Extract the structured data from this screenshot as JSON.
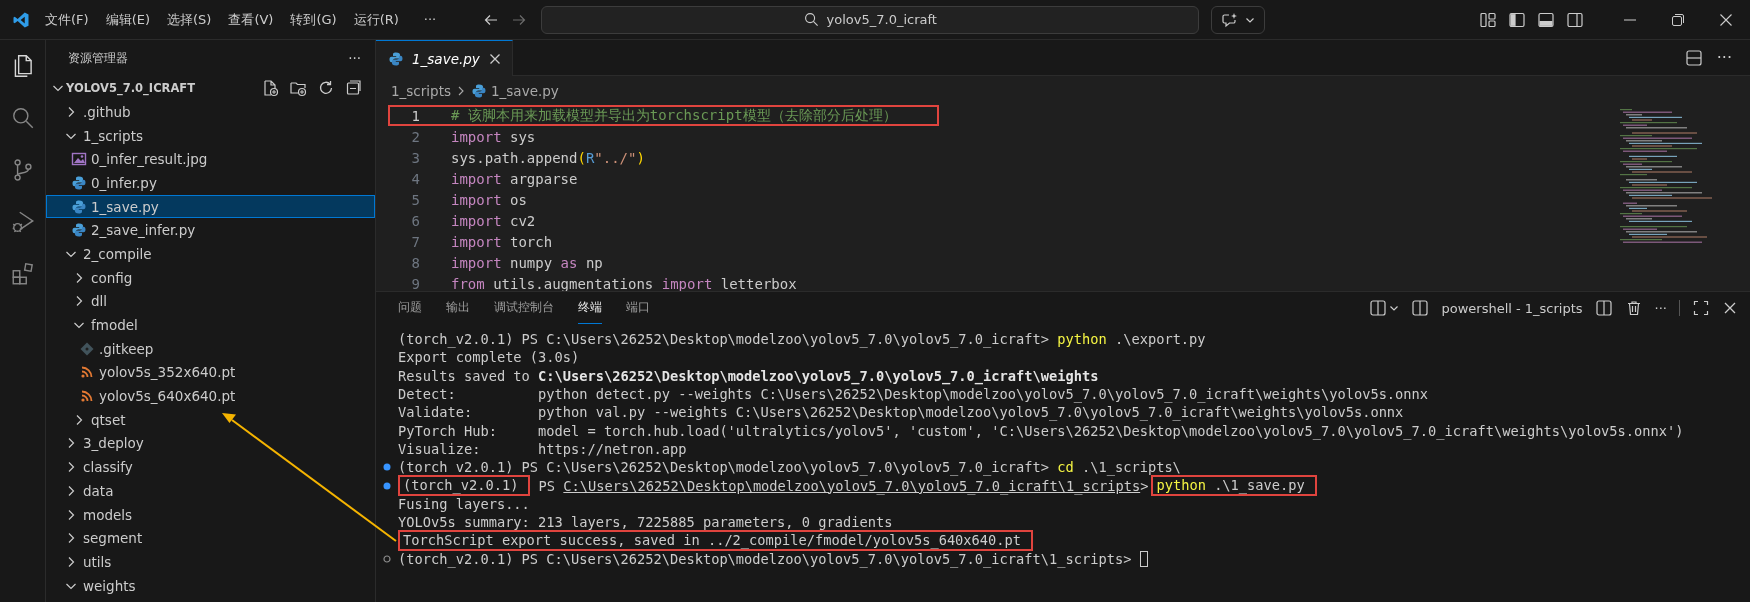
{
  "title_bar": {
    "menus": [
      "文件(F)",
      "编辑(E)",
      "选择(S)",
      "查看(V)",
      "转到(G)",
      "运行(R)"
    ],
    "more": "···",
    "back_disabled": false,
    "forward_disabled": true,
    "search": {
      "value": "yolov5_7.0_icraft"
    }
  },
  "activity_bar": [
    {
      "kind": "explorer",
      "selected": true
    },
    {
      "kind": "search",
      "selected": false
    },
    {
      "kind": "source-control",
      "selected": false
    },
    {
      "kind": "run-debug",
      "selected": false
    },
    {
      "kind": "extensions",
      "selected": false
    }
  ],
  "explorer": {
    "title": "资源管理器",
    "more": "···",
    "root": {
      "label": "YOLOV5_7.0_ICRAFT",
      "expanded": true
    },
    "tree": [
      {
        "label": ".github",
        "kind": "folder",
        "expanded": false,
        "selected": false
      },
      {
        "label": "1_scripts",
        "kind": "folder",
        "expanded": true,
        "selected": false,
        "children": [
          {
            "label": "0_infer_result.jpg",
            "kind": "image",
            "selected": false
          },
          {
            "label": "0_infer.py",
            "kind": "python",
            "selected": false
          },
          {
            "label": "1_save.py",
            "kind": "python",
            "selected": true
          },
          {
            "label": "2_save_infer.py",
            "kind": "python",
            "selected": false
          }
        ]
      },
      {
        "label": "2_compile",
        "kind": "folder",
        "expanded": true,
        "selected": false,
        "children": [
          {
            "label": "config",
            "kind": "folder",
            "expanded": false,
            "selected": false
          },
          {
            "label": "dll",
            "kind": "folder",
            "expanded": false,
            "selected": false
          },
          {
            "label": "fmodel",
            "kind": "folder",
            "expanded": true,
            "selected": false,
            "children": [
              {
                "label": ".gitkeep",
                "kind": "git",
                "selected": false
              },
              {
                "label": "yolov5s_352x640.pt",
                "kind": "model",
                "selected": false
              },
              {
                "label": "yolov5s_640x640.pt",
                "kind": "model",
                "selected": false,
                "pointed": true
              }
            ]
          },
          {
            "label": "qtset",
            "kind": "folder",
            "expanded": false,
            "selected": false
          }
        ]
      },
      {
        "label": "3_deploy",
        "kind": "folder",
        "expanded": false,
        "selected": false
      },
      {
        "label": "classify",
        "kind": "folder",
        "expanded": false,
        "selected": false
      },
      {
        "label": "data",
        "kind": "folder",
        "expanded": false,
        "selected": false
      },
      {
        "label": "models",
        "kind": "folder",
        "expanded": false,
        "selected": false
      },
      {
        "label": "segment",
        "kind": "folder",
        "expanded": false,
        "selected": false
      },
      {
        "label": "utils",
        "kind": "folder",
        "expanded": false,
        "selected": false
      },
      {
        "label": "weights",
        "kind": "folder",
        "expanded": true,
        "selected": false
      }
    ]
  },
  "editor": {
    "tabs": [
      {
        "label": "1_save.py",
        "selected": true
      }
    ],
    "more": "···",
    "breadcrumb": [
      "1_scripts",
      "1_save.py"
    ],
    "lines": [
      {
        "number": "1",
        "boxed": true,
        "tokens": [
          {
            "text": "# 该脚本用来加载模型并导出为torchscript模型（去除部分后处理）",
            "kind": "comment"
          }
        ]
      },
      {
        "number": "2",
        "boxed": false,
        "tokens": [
          {
            "text": "import",
            "kind": "keyword"
          },
          {
            "text": " sys",
            "kind": "plain"
          }
        ]
      },
      {
        "number": "3",
        "boxed": false,
        "tokens": [
          {
            "text": "sys.path.append",
            "kind": "plain"
          },
          {
            "text": "(",
            "kind": "bracket"
          },
          {
            "text": "R",
            "kind": "prefix"
          },
          {
            "text": "\"../\"",
            "kind": "string"
          },
          {
            "text": ")",
            "kind": "bracket"
          }
        ]
      },
      {
        "number": "4",
        "boxed": false,
        "tokens": [
          {
            "text": "import",
            "kind": "keyword"
          },
          {
            "text": " argparse",
            "kind": "plain"
          }
        ]
      },
      {
        "number": "5",
        "boxed": false,
        "tokens": [
          {
            "text": "import",
            "kind": "keyword"
          },
          {
            "text": " os",
            "kind": "plain"
          }
        ]
      },
      {
        "number": "6",
        "boxed": false,
        "tokens": [
          {
            "text": "import",
            "kind": "keyword"
          },
          {
            "text": " cv2",
            "kind": "plain"
          }
        ]
      },
      {
        "number": "7",
        "boxed": false,
        "tokens": [
          {
            "text": "import",
            "kind": "keyword"
          },
          {
            "text": " torch",
            "kind": "plain"
          }
        ]
      },
      {
        "number": "8",
        "boxed": false,
        "tokens": [
          {
            "text": "import",
            "kind": "keyword"
          },
          {
            "text": " numpy ",
            "kind": "plain"
          },
          {
            "text": "as",
            "kind": "keyword"
          },
          {
            "text": " np",
            "kind": "plain"
          }
        ]
      },
      {
        "number": "9",
        "boxed": false,
        "tokens": [
          {
            "text": "from",
            "kind": "keyword"
          },
          {
            "text": " utils.augmentations ",
            "kind": "plain"
          },
          {
            "text": "import",
            "kind": "keyword"
          },
          {
            "text": " letterbox",
            "kind": "plain"
          }
        ]
      }
    ]
  },
  "panel": {
    "tabs": [
      {
        "label": "问题",
        "selected": false
      },
      {
        "label": "输出",
        "selected": false
      },
      {
        "label": "调试控制台",
        "selected": false
      },
      {
        "label": "终端",
        "selected": true
      },
      {
        "label": "端口",
        "selected": false
      }
    ],
    "terminal_name": "powershell - 1_scripts",
    "more": "···",
    "lines": [
      {
        "decorated": false,
        "cursor": false,
        "segments": [
          {
            "text": "(torch_v2.0.1) PS C:\\Users\\26252\\Desktop\\modelzoo\\yolov5_7.0\\yolov5_7.0_icraft> ",
            "kind": "plain"
          },
          {
            "text": "python",
            "kind": "command"
          },
          {
            "text": " .\\export.py",
            "kind": "plain"
          }
        ]
      },
      {
        "decorated": false,
        "cursor": false,
        "segments": [
          {
            "text": "Export complete (3.0s)",
            "kind": "plain"
          }
        ]
      },
      {
        "decorated": false,
        "cursor": false,
        "segments": [
          {
            "text": "Results saved to ",
            "kind": "plain"
          },
          {
            "text": "C:\\Users\\26252\\Desktop\\modelzoo\\yolov5_7.0\\yolov5_7.0_icraft\\weights",
            "kind": "bold"
          }
        ]
      },
      {
        "decorated": false,
        "cursor": false,
        "segments": [
          {
            "text": "Detect:          python detect.py --weights C:\\Users\\26252\\Desktop\\modelzoo\\yolov5_7.0\\yolov5_7.0_icraft\\weights\\yolov5s.onnx",
            "kind": "plain"
          }
        ]
      },
      {
        "decorated": false,
        "cursor": false,
        "segments": [
          {
            "text": "Validate:        python val.py --weights C:\\Users\\26252\\Desktop\\modelzoo\\yolov5_7.0\\yolov5_7.0_icraft\\weights\\yolov5s.onnx",
            "kind": "plain"
          }
        ]
      },
      {
        "decorated": false,
        "cursor": false,
        "segments": [
          {
            "text": "PyTorch Hub:     model = torch.hub.load('ultralytics/yolov5', 'custom', 'C:\\Users\\26252\\Desktop\\modelzoo\\yolov5_7.0\\yolov5_7.0_icraft\\weights\\yolov5s.onnx')",
            "kind": "plain"
          }
        ]
      },
      {
        "decorated": false,
        "cursor": false,
        "segments": [
          {
            "text": "Visualize:       https://netron.app",
            "kind": "plain"
          }
        ]
      },
      {
        "decorated": true,
        "succeeded": true,
        "cursor": false,
        "segments": [
          {
            "text": "(torch_v2.0.1) PS C:\\Users\\26252\\Desktop\\modelzoo\\yolov5_7.0\\yolov5_7.0_icraft> ",
            "kind": "plain"
          },
          {
            "text": "cd",
            "kind": "command"
          },
          {
            "text": " .\\1_scripts\\",
            "kind": "plain"
          }
        ]
      },
      {
        "decorated": true,
        "succeeded": true,
        "cursor": false,
        "segments": [
          {
            "kind": "boxed",
            "segments": [
              {
                "text": "(torch_v2.0.1)",
                "kind": "plain"
              }
            ]
          },
          {
            "text": " PS ",
            "kind": "plain"
          },
          {
            "text": "C:\\Users\\26252\\Desktop\\modelzoo\\yolov5_7.0\\yolov5_7.0_icraft\\1_scripts",
            "kind": "link"
          },
          {
            "text": ">",
            "kind": "plain"
          },
          {
            "kind": "boxed",
            "segments": [
              {
                "text": "python",
                "kind": "command"
              },
              {
                "text": " .\\1_save.py",
                "kind": "plain"
              }
            ]
          }
        ]
      },
      {
        "decorated": false,
        "cursor": false,
        "segments": [
          {
            "text": "Fusing layers... ",
            "kind": "plain"
          }
        ]
      },
      {
        "decorated": false,
        "cursor": false,
        "segments": [
          {
            "text": "YOLOv5s summary: 213 layers, 7225885 parameters, 0 gradients",
            "kind": "plain"
          }
        ]
      },
      {
        "decorated": false,
        "cursor": false,
        "segments": [
          {
            "kind": "boxed",
            "segments": [
              {
                "text": "TorchScript export success, saved in ../2_compile/fmodel/yolov5s_640x640.pt",
                "kind": "plain"
              }
            ]
          }
        ]
      },
      {
        "decorated": true,
        "succeeded": false,
        "cursor": true,
        "segments": [
          {
            "text": "(torch_v2.0.1) PS C:\\Users\\26252\\Desktop\\modelzoo\\yolov5_7.0\\yolov5_7.0_icraft\\1_scripts> ",
            "kind": "plain"
          }
        ]
      }
    ]
  }
}
